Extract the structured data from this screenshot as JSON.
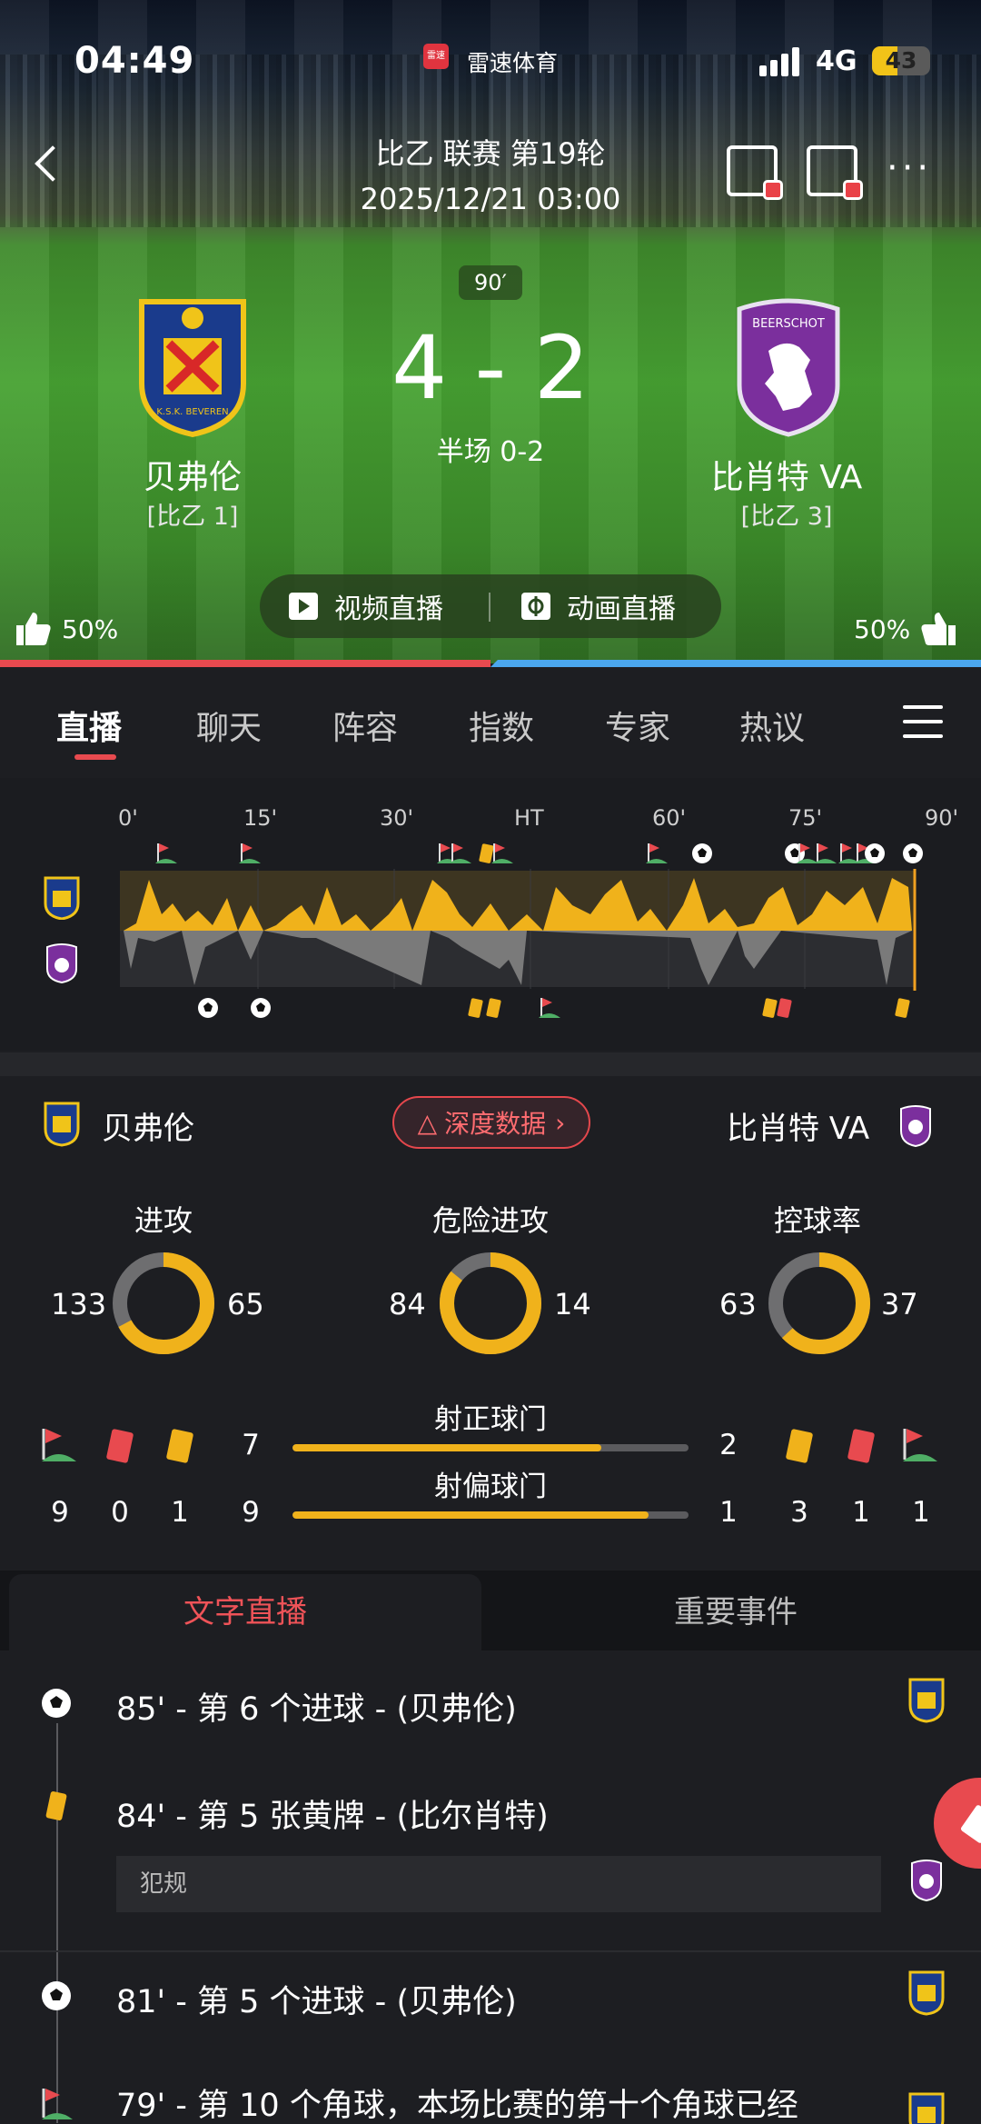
{
  "status_bar": {
    "time": "04:49",
    "app_badge": "雷速",
    "app_name": "雷速体育",
    "network": "4G",
    "battery": "43",
    "battery_level": 0.43
  },
  "header": {
    "league": "比乙 联赛 第19轮",
    "datetime": "2025/12/21 03:00"
  },
  "match": {
    "minute": "90′",
    "score": "4 - 2",
    "half_time": "半场 0-2",
    "home": {
      "name": "贝弗伦",
      "rank": "[比乙 1]",
      "crest_text": "K.S.K. BEVEREN"
    },
    "away": {
      "name": "比肖特 VA",
      "rank": "[比乙 3]",
      "crest_text": "BEERSCHOT"
    }
  },
  "live_buttons": {
    "video": "视频直播",
    "animation": "动画直播"
  },
  "votes": {
    "home": "50%",
    "away": "50%"
  },
  "tabs": [
    "直播",
    "聊天",
    "阵容",
    "指数",
    "专家",
    "热议"
  ],
  "momentum": {
    "ticks": [
      "0'",
      "15'",
      "30'",
      "HT",
      "60'",
      "75'",
      "90'"
    ]
  },
  "stats": {
    "home_name": "贝弗伦",
    "away_name": "比肖特 VA",
    "deep_data": "深度数据",
    "rings": [
      {
        "title": "进攻",
        "home": "133",
        "away": "65",
        "home_share": 0.672
      },
      {
        "title": "危险进攻",
        "home": "84",
        "away": "14",
        "home_share": 0.857
      },
      {
        "title": "控球率",
        "home": "63",
        "away": "37",
        "home_share": 0.63
      }
    ],
    "on_target": {
      "label": "射正球门",
      "home": "7",
      "away": "2",
      "home_share": 0.78
    },
    "off_target": {
      "label": "射偏球门",
      "home": "9",
      "away": "1",
      "home_share": 0.9
    },
    "home_corners": "9",
    "home_red": "0",
    "home_yellow": "1",
    "away_yellow": "3",
    "away_red": "1",
    "away_corners": "1"
  },
  "text_live": {
    "tab_active": "文字直播",
    "tab_other": "重要事件",
    "events": [
      {
        "icon": "football-icon",
        "text": "85' - 第 6 个进球 - (贝弗伦)",
        "team": "home"
      },
      {
        "icon": "yellow-card-icon",
        "text": "84' - 第 5 张黄牌 - (比尔肖特)",
        "sub": "犯规",
        "team": "away"
      },
      {
        "icon": "football-icon",
        "text": "81' - 第 5 个进球 - (贝弗伦)",
        "team": "home"
      },
      {
        "icon": "corner-flag-icon",
        "text": "79' - 第 10 个角球，本场比赛的第十个角球已经",
        "team": "home"
      }
    ]
  },
  "colors": {
    "accent_red": "#e84a4f",
    "accent_blue": "#4ba7ee",
    "home_yellow": "#f0b21b",
    "away_gray": "#7a7a7a"
  }
}
